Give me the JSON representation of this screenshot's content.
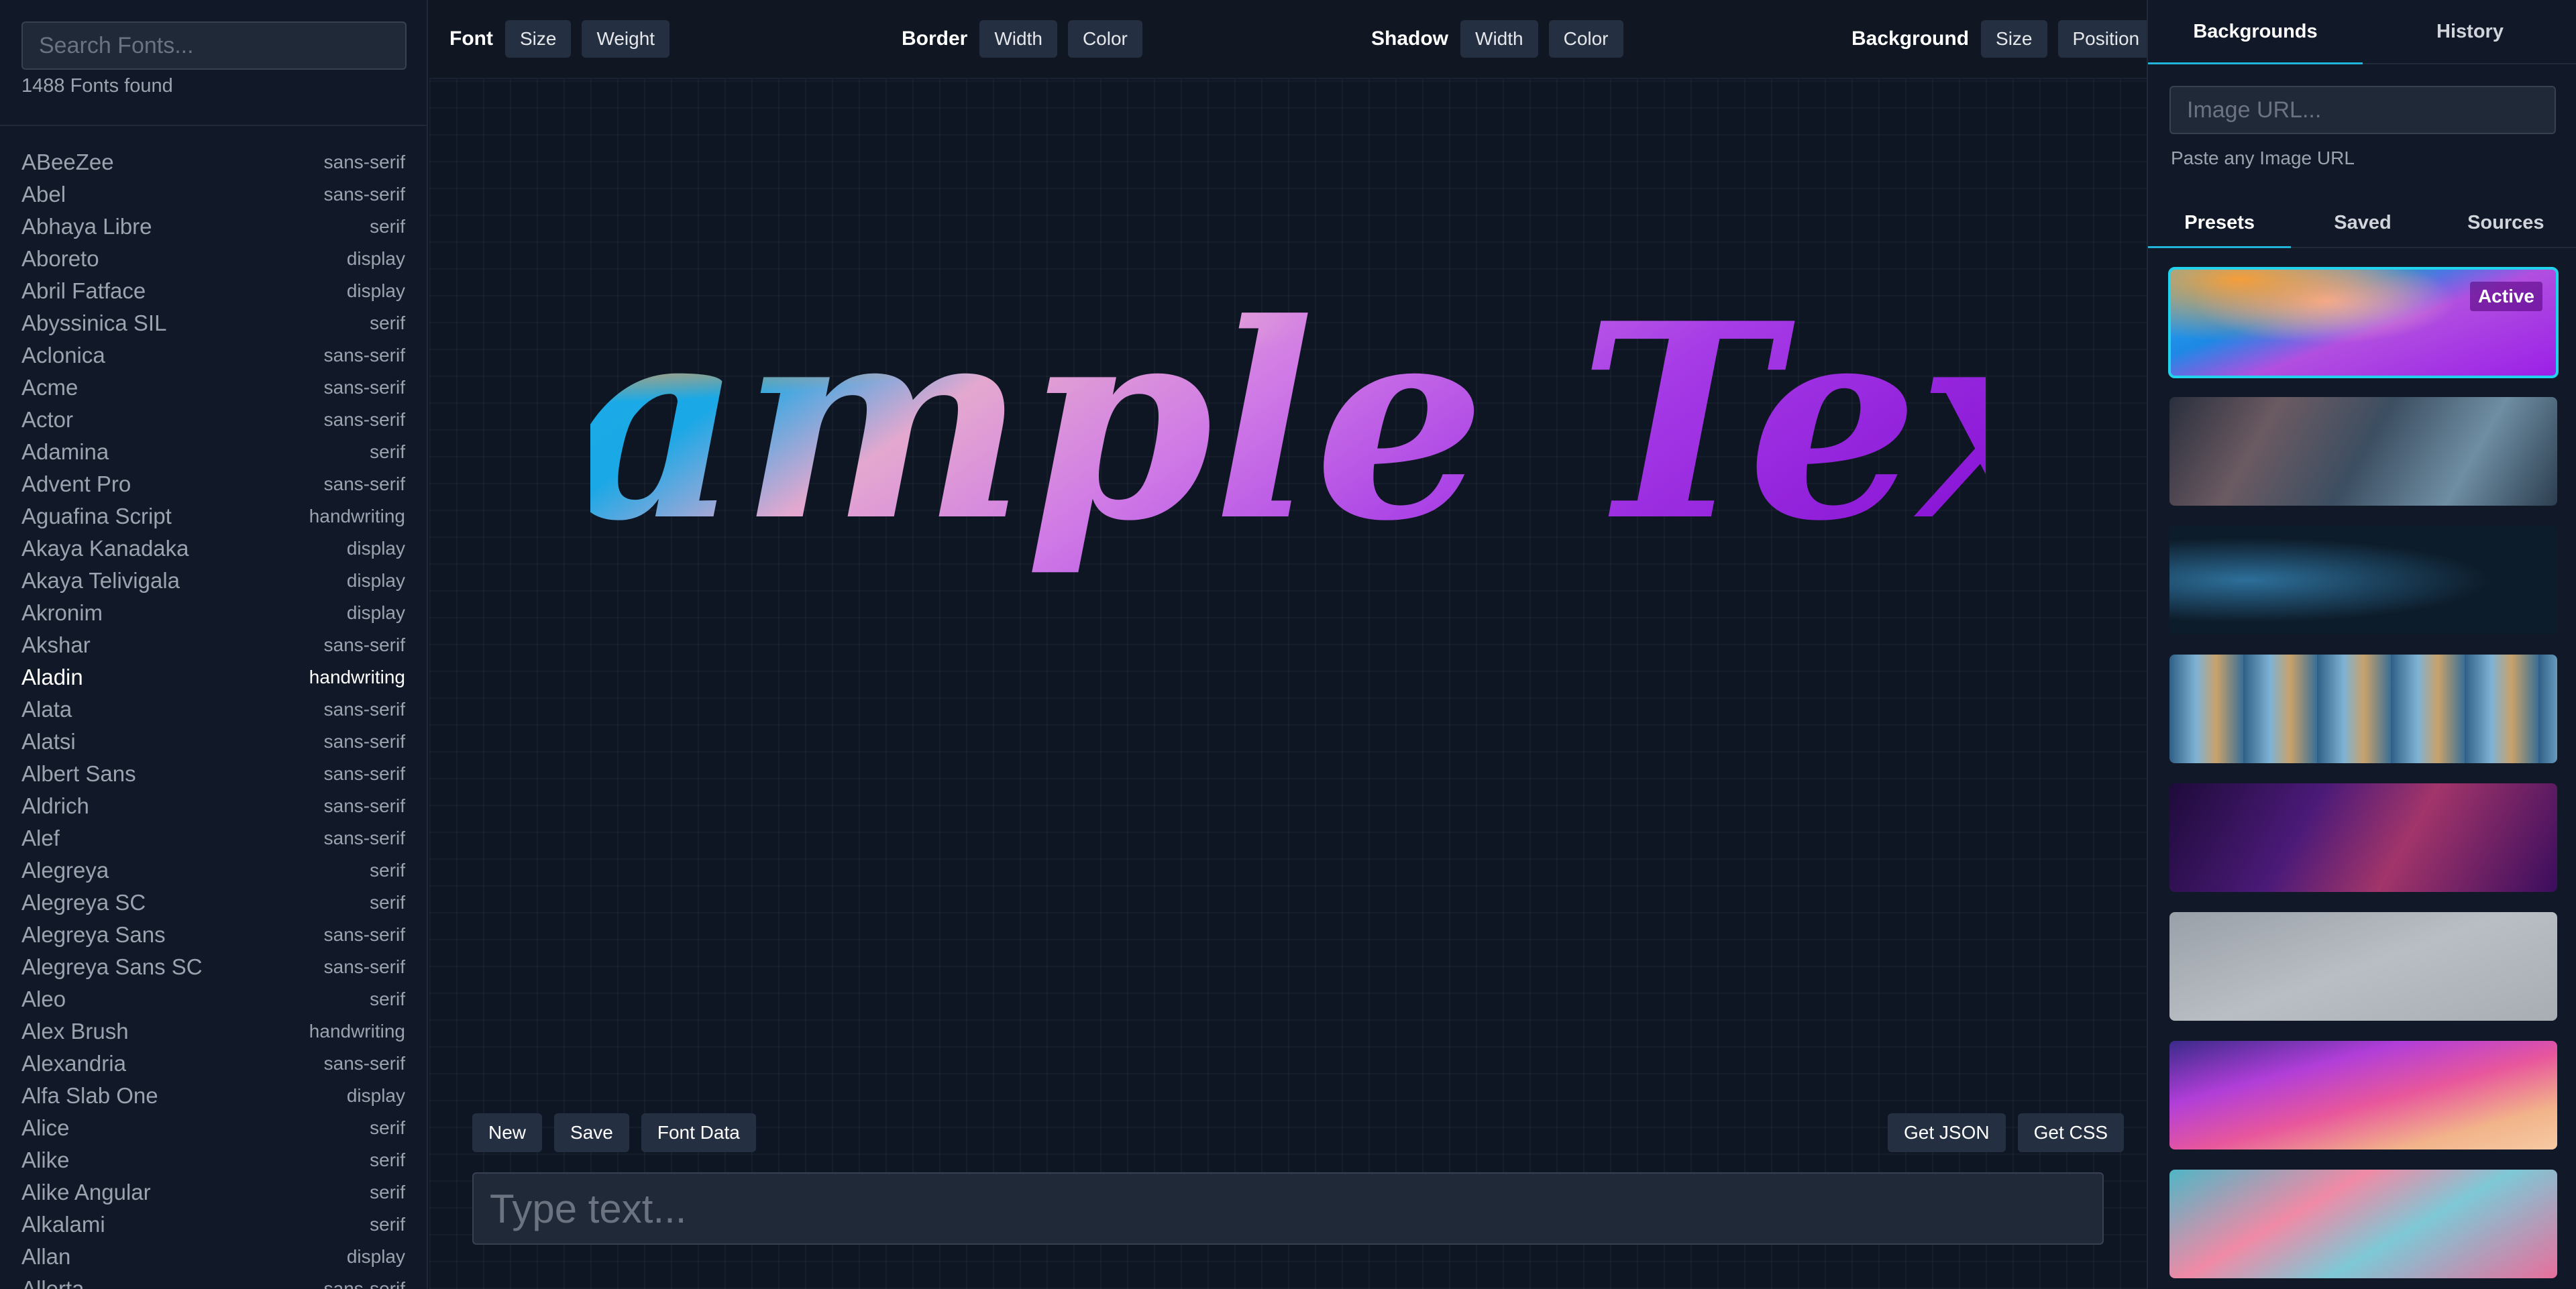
{
  "sidebar": {
    "search_placeholder": "Search Fonts...",
    "fonts_found": "1488 Fonts found",
    "fonts": [
      {
        "name": "ABeeZee",
        "category": "sans-serif"
      },
      {
        "name": "Abel",
        "category": "sans-serif"
      },
      {
        "name": "Abhaya Libre",
        "category": "serif"
      },
      {
        "name": "Aboreto",
        "category": "display"
      },
      {
        "name": "Abril Fatface",
        "category": "display"
      },
      {
        "name": "Abyssinica SIL",
        "category": "serif"
      },
      {
        "name": "Aclonica",
        "category": "sans-serif"
      },
      {
        "name": "Acme",
        "category": "sans-serif"
      },
      {
        "name": "Actor",
        "category": "sans-serif"
      },
      {
        "name": "Adamina",
        "category": "serif"
      },
      {
        "name": "Advent Pro",
        "category": "sans-serif"
      },
      {
        "name": "Aguafina Script",
        "category": "handwriting"
      },
      {
        "name": "Akaya Kanadaka",
        "category": "display"
      },
      {
        "name": "Akaya Telivigala",
        "category": "display"
      },
      {
        "name": "Akronim",
        "category": "display"
      },
      {
        "name": "Akshar",
        "category": "sans-serif"
      },
      {
        "name": "Aladin",
        "category": "handwriting",
        "selected": true
      },
      {
        "name": "Alata",
        "category": "sans-serif"
      },
      {
        "name": "Alatsi",
        "category": "sans-serif"
      },
      {
        "name": "Albert Sans",
        "category": "sans-serif"
      },
      {
        "name": "Aldrich",
        "category": "sans-serif"
      },
      {
        "name": "Alef",
        "category": "sans-serif"
      },
      {
        "name": "Alegreya",
        "category": "serif"
      },
      {
        "name": "Alegreya SC",
        "category": "serif"
      },
      {
        "name": "Alegreya Sans",
        "category": "sans-serif"
      },
      {
        "name": "Alegreya Sans SC",
        "category": "sans-serif"
      },
      {
        "name": "Aleo",
        "category": "serif"
      },
      {
        "name": "Alex Brush",
        "category": "handwriting"
      },
      {
        "name": "Alexandria",
        "category": "sans-serif"
      },
      {
        "name": "Alfa Slab One",
        "category": "display"
      },
      {
        "name": "Alice",
        "category": "serif"
      },
      {
        "name": "Alike",
        "category": "serif"
      },
      {
        "name": "Alike Angular",
        "category": "serif"
      },
      {
        "name": "Alkalami",
        "category": "serif"
      },
      {
        "name": "Allan",
        "category": "display"
      },
      {
        "name": "Allerta",
        "category": "sans-serif"
      }
    ]
  },
  "toolbar": {
    "font": {
      "label": "Font",
      "size": "Size",
      "weight": "Weight"
    },
    "border": {
      "label": "Border",
      "width": "Width",
      "color": "Color"
    },
    "shadow": {
      "label": "Shadow",
      "width": "Width",
      "color": "Color"
    },
    "background": {
      "label": "Background",
      "size": "Size",
      "position": "Position"
    }
  },
  "canvas": {
    "sample_text": "Sample Text",
    "actions": {
      "new": "New",
      "save": "Save",
      "font_data": "Font Data",
      "get_json": "Get JSON",
      "get_css": "Get CSS"
    },
    "text_placeholder": "Type text..."
  },
  "right_panel": {
    "tabs": [
      {
        "label": "Backgrounds",
        "active": true
      },
      {
        "label": "History",
        "active": false
      }
    ],
    "url_placeholder": "Image URL...",
    "url_hint": "Paste any Image URL",
    "sub_tabs": [
      {
        "label": "Presets",
        "active": true
      },
      {
        "label": "Saved",
        "active": false
      },
      {
        "label": "Sources",
        "active": false
      }
    ],
    "active_badge": "Active",
    "preset_count": 8
  },
  "colors": {
    "background": "#0f1623",
    "panel": "#111827",
    "button": "#243041",
    "accent": "#22d3ee",
    "text_gradient": [
      "#f7913a",
      "#1fb4ea",
      "#f4a7c4",
      "#d37be8",
      "#9b1fe8",
      "#8a16d6"
    ]
  },
  "icons": []
}
